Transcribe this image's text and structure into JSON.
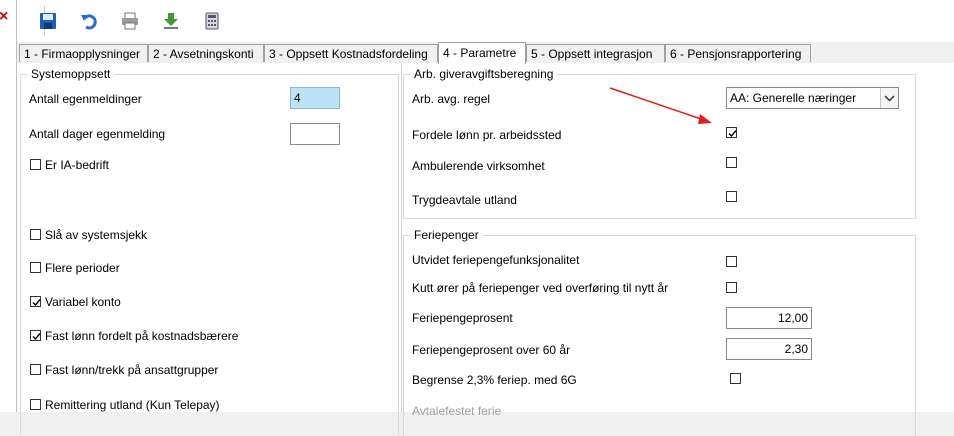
{
  "window": {
    "close_glyph": "×"
  },
  "toolbar": {
    "icons": [
      "save-icon",
      "undo-icon",
      "print-icon",
      "download-icon",
      "calculator-icon"
    ]
  },
  "tabs": [
    {
      "label": "1 - Firmaopplysninger"
    },
    {
      "label": "2 - Avsetningskonti"
    },
    {
      "label": "3 - Oppsett Kostnadsfordeling"
    },
    {
      "label": "4 - Parametre"
    },
    {
      "label": "5 - Oppsett integrasjon"
    },
    {
      "label": "6 - Pensjonsrapportering"
    }
  ],
  "active_tab": "4 - Parametre",
  "systemoppsett": {
    "title": "Systemoppsett",
    "antall_egenmeldinger": {
      "label": "Antall egenmeldinger",
      "value": "4"
    },
    "antall_dager": {
      "label": "Antall dager egenmelding",
      "value": ""
    },
    "checkboxes": [
      {
        "label": "Er IA-bedrift",
        "checked": false
      },
      {
        "label": "Slå av systemsjekk",
        "checked": false
      },
      {
        "label": "Flere perioder",
        "checked": false
      },
      {
        "label": "Variabel konto",
        "checked": true
      },
      {
        "label": "Fast lønn fordelt på kostnadsbærere",
        "checked": true
      },
      {
        "label": "Fast lønn/trekk på ansattgrupper",
        "checked": false
      },
      {
        "label": "Remittering utland (Kun Telepay)",
        "checked": false
      }
    ]
  },
  "arbgiver": {
    "title": "Arb. giveravgiftsberegning",
    "regel_label": "Arb. avg. regel",
    "regel_value": "AA: Generelle næringer",
    "fordele": {
      "label": "Fordele lønn pr. arbeidssted",
      "checked": true
    },
    "ambulerende": {
      "label": "Ambulerende virksomhet",
      "checked": false
    },
    "trygdeavtale": {
      "label": "Trygdeavtale utland",
      "checked": false
    }
  },
  "feriepenger": {
    "title": "Feriepenger",
    "utvidet": {
      "label": "Utvidet feriepengefunksjonalitet",
      "checked": false
    },
    "kutt": {
      "label": "Kutt ører på feriepenger ved overføring til nytt år",
      "checked": false
    },
    "prosent": {
      "label": "Feriepengeprosent",
      "value": "12,00"
    },
    "prosent60": {
      "label": "Feriepengeprosent over 60 år",
      "value": "2,30"
    },
    "begrense": {
      "label": "Begrense 2,3% feriep. med 6G",
      "checked": false
    },
    "avtalefestet": {
      "label": "Avtalefestet ferie"
    }
  },
  "colors": {
    "arrow": "#e02020",
    "highlight": "#bde3f7"
  }
}
